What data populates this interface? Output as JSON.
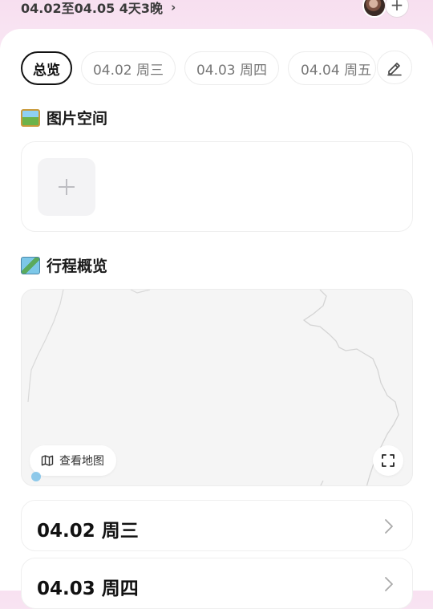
{
  "header": {
    "trip_range": "04.02至04.05 4天3晚",
    "add_member": "+"
  },
  "tabs": [
    {
      "label": "总览",
      "active": true
    },
    {
      "label": "04.02 周三",
      "active": false
    },
    {
      "label": "04.03 周四",
      "active": false
    },
    {
      "label": "04.04 周五",
      "active": false
    }
  ],
  "photos": {
    "title": "图片空间",
    "add_label": "+"
  },
  "overview": {
    "title": "行程概览",
    "view_map_label": "查看地图"
  },
  "days": [
    {
      "label": "04.02 周三"
    },
    {
      "label": "04.03 周四"
    }
  ],
  "icons": {
    "edit": "pencil-icon",
    "expand": "chevron-right-icon",
    "map": "map-icon",
    "fullscreen": "fullscreen-icon"
  }
}
